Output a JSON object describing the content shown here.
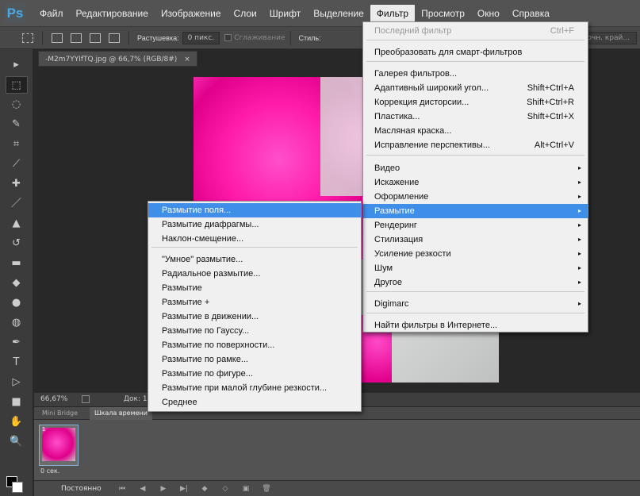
{
  "app": {
    "logo": "Ps"
  },
  "menubar": {
    "items": [
      "Файл",
      "Редактирование",
      "Изображение",
      "Слои",
      "Шрифт",
      "Выделение",
      "Фильтр",
      "Просмотр",
      "Окно",
      "Справка"
    ],
    "active_index": 6
  },
  "options": {
    "feather_label": "Растушевка:",
    "feather_value": "0 пикс.",
    "antialias_label": "Сглаживание",
    "style_label": "Стиль:",
    "refine_label": "Уточн. край..."
  },
  "document": {
    "tab_title": "-M2m7YYIfTQ.jpg @ 66,7% (RGB/8#)",
    "close": "×",
    "zoom": "66,67%",
    "doc_info": "Док: 1"
  },
  "tools": [
    "move-icon",
    "marquee-icon",
    "lasso-icon",
    "quick-select-icon",
    "crop-icon",
    "eyedropper-icon",
    "healing-icon",
    "brush-icon",
    "stamp-icon",
    "history-brush-icon",
    "eraser-icon",
    "bucket-icon",
    "blur-icon",
    "dodge-icon",
    "pen-icon",
    "type-icon",
    "path-select-icon",
    "shape-icon",
    "hand-icon",
    "zoom-icon"
  ],
  "tool_glyphs": [
    "▸",
    "⬚",
    "◌",
    "✎",
    "⌗",
    "⟋",
    "✚",
    "／",
    "▲",
    "↺",
    "▬",
    "◆",
    "●",
    "◍",
    "✒",
    "T",
    "▷",
    "■",
    "✋",
    "🔍"
  ],
  "panel": {
    "tabs": [
      "Mini Bridge",
      "Шкала времени"
    ],
    "active_tab": 1,
    "frame_number": "1",
    "frame_time": "0 сек.",
    "loop_label": "Постоянно",
    "controls": [
      "⏮",
      "◀",
      "▶",
      "▶|",
      "◆",
      "◇",
      "▣",
      "🗑"
    ]
  },
  "filter_menu": {
    "items": [
      {
        "label": "Последний фильтр",
        "shortcut": "Ctrl+F",
        "disabled": true
      },
      {
        "label": "Преобразовать для смарт-фильтров"
      },
      {
        "label": "Галерея фильтров..."
      },
      {
        "label": "Адаптивный широкий угол...",
        "shortcut": "Shift+Ctrl+A"
      },
      {
        "label": "Коррекция дисторсии...",
        "shortcut": "Shift+Ctrl+R"
      },
      {
        "label": "Пластика...",
        "shortcut": "Shift+Ctrl+X"
      },
      {
        "label": "Масляная краска..."
      },
      {
        "label": "Исправление перспективы...",
        "shortcut": "Alt+Ctrl+V"
      },
      {
        "label": "Видео",
        "submenu": true
      },
      {
        "label": "Искажение",
        "submenu": true
      },
      {
        "label": "Оформление",
        "submenu": true
      },
      {
        "label": "Размытие",
        "submenu": true,
        "highlighted": true
      },
      {
        "label": "Рендеринг",
        "submenu": true
      },
      {
        "label": "Стилизация",
        "submenu": true
      },
      {
        "label": "Усиление резкости",
        "submenu": true
      },
      {
        "label": "Шум",
        "submenu": true
      },
      {
        "label": "Другое",
        "submenu": true
      },
      {
        "label": "Digimarc",
        "submenu": true
      },
      {
        "label": "Найти фильтры в Интернете..."
      }
    ],
    "arrow": "▸"
  },
  "blur_submenu": {
    "items": [
      {
        "label": "Размытие поля...",
        "highlighted": true
      },
      {
        "label": "Размытие диафрагмы..."
      },
      {
        "label": "Наклон-смещение..."
      },
      {
        "label": "\"Умное\" размытие..."
      },
      {
        "label": "Радиальное размытие..."
      },
      {
        "label": "Размытие"
      },
      {
        "label": "Размытие +"
      },
      {
        "label": "Размытие в движении..."
      },
      {
        "label": "Размытие по Гауссу..."
      },
      {
        "label": "Размытие по поверхности..."
      },
      {
        "label": "Размытие по рамке..."
      },
      {
        "label": "Размытие по фигуре..."
      },
      {
        "label": "Размытие при малой глубине резкости..."
      },
      {
        "label": "Среднее"
      }
    ]
  },
  "colors": {
    "accent": "#3f8ee8",
    "flower": "#ff1aa8"
  }
}
